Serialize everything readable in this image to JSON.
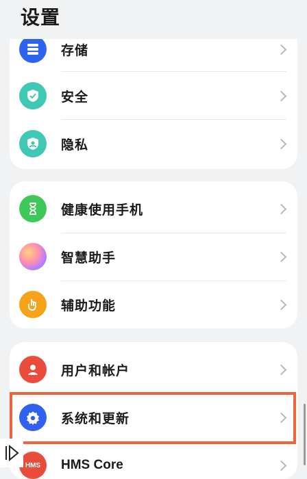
{
  "header": {
    "title": "设置"
  },
  "groups": [
    {
      "items": [
        {
          "label": "存储",
          "icon": "storage-icon",
          "color": "#2f62f0"
        },
        {
          "label": "安全",
          "icon": "shield-check-icon",
          "color": "#3fc8b4"
        },
        {
          "label": "隐私",
          "icon": "privacy-shield-icon",
          "color": "#3fc8b4"
        }
      ]
    },
    {
      "items": [
        {
          "label": "健康使用手机",
          "icon": "hourglass-icon",
          "color": "#3fc85a"
        },
        {
          "label": "智慧助手",
          "icon": "assistant-orb-icon",
          "color": "gradient"
        },
        {
          "label": "辅助功能",
          "icon": "hand-touch-icon",
          "color": "#f6a31a"
        }
      ]
    },
    {
      "items": [
        {
          "label": "用户和帐户",
          "icon": "user-icon",
          "color": "#ea4c3c"
        },
        {
          "label": "系统和更新",
          "icon": "gear-icon",
          "color": "#2f62f0",
          "highlighted": true
        },
        {
          "label": "HMS Core",
          "icon": "hms-logo-icon",
          "color": "#ea4c3c",
          "icon_text": "HMS"
        }
      ]
    }
  ],
  "highlight_color": "#f0643c"
}
